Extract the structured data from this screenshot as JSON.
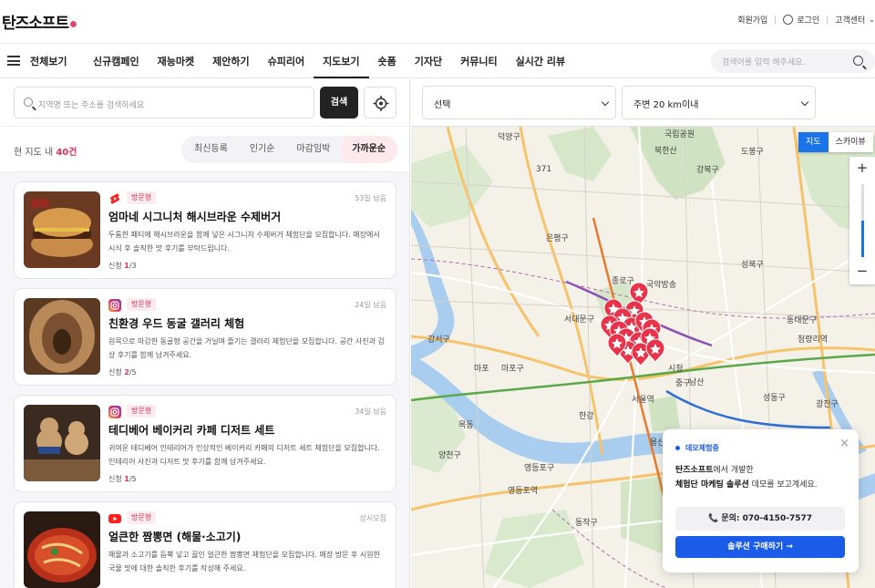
{
  "header": {
    "logo": "탄즈소프트",
    "links": [
      "회원가입",
      "로그인",
      "고객센터"
    ]
  },
  "nav": {
    "all_label": "전체보기",
    "items": [
      "신규캠페인",
      "재능마켓",
      "제안하기",
      "슈피리어",
      "지도보기",
      "숏폼",
      "기자단",
      "커뮤니티",
      "실시간 리뷰"
    ],
    "active": "지도보기",
    "search_placeholder": "검색어를 입력 해주세요."
  },
  "left": {
    "search_placeholder": "지역명 또는 주소를 검색하세요",
    "search_button": "검색",
    "count_prefix": "현 지도 내 ",
    "count_value": "40건",
    "sort_options": [
      "최신등록",
      "인기순",
      "마감임박",
      "가까운순"
    ],
    "sort_active": "가까운순"
  },
  "cards": [
    {
      "platform": "youtube-shorts",
      "badge": "방문형",
      "days_left": "53일 남음",
      "title": "엄마네 시그니처 해시브라운 수제버거",
      "desc": "두툼한 패티에 해시브라운을 함께 넣은 시그니처 수제버거 체험단을 모집합니다. 매장에서 시식 후 솔직한 맛 후기를 부탁드립니다.",
      "slots_label": "신청 ",
      "slots_current": "1",
      "slots_total": "/3"
    },
    {
      "platform": "instagram",
      "badge": "방문형",
      "days_left": "24일 남음",
      "title": "친환경 우드 동굴 갤러리 체험",
      "desc": "원목으로 마감한 동굴형 공간을 거닐며 즐기는 갤러리 체험단을 모집합니다. 공간 사진과 감상 후기를 함께 남겨주세요.",
      "slots_label": "신청 ",
      "slots_current": "2",
      "slots_total": "/5"
    },
    {
      "platform": "instagram",
      "badge": "방문형",
      "days_left": "34일 남음",
      "title": "테디베어 베이커리 카페 디저트 세트",
      "desc": "귀여운 테디베어 인테리어가 인상적인 베이커리 카페의 디저트 세트 체험단을 모집합니다. 인테리어 사진과 디저트 맛 후기를 함께 남겨주세요.",
      "slots_label": "신청 ",
      "slots_current": "1",
      "slots_total": "/5"
    },
    {
      "platform": "youtube",
      "badge": "방문형",
      "days_left": "상시모집",
      "title": "얼큰한 짬뽕면 (해물·소고기)",
      "desc": "해물과 소고기를 듬뿍 넣고 끓인 얼큰한 짬뽕면 체험단을 모집합니다. 매장 방문 후 시원한 국물 맛에 대한 솔직한 후기를 작성해 주세요.",
      "slots_label": "",
      "slots_current": "",
      "slots_total": ""
    }
  ],
  "map": {
    "filter_region": "선택",
    "filter_radius": "주변 20 km이내",
    "type_buttons": [
      "지도",
      "스카이뷰"
    ],
    "type_active": "지도",
    "zoom_plus": "+",
    "zoom_minus": "−",
    "zoom_level": 0.5,
    "labels": [
      "덕양구",
      "국립공원",
      "북한산",
      "강북구",
      "도봉구",
      "은평구",
      "성북구",
      "종로구",
      "국악방송",
      "서대문구",
      "인왕산",
      "동대문구",
      "청량리역",
      "마포구",
      "마포",
      "시청",
      "중구",
      "서울역",
      "성동구",
      "광진구",
      "강서구",
      "양천구",
      "영등포구",
      "동작구",
      "용산구",
      "남산",
      "목동",
      "영등포역",
      "한강",
      "371"
    ],
    "marker_count": 16,
    "marker_color": "#e8334a"
  },
  "demo": {
    "tag": "데모체험중",
    "close": "×",
    "brand": "탄즈소프트",
    "line1_suffix": "에서 개발한",
    "line2_bold": "체험단 마케팅 솔루션",
    "line2_suffix": " 데모를 보고계세요.",
    "phone": "문의: 070-4150-7577",
    "buy": "솔루션 구매하기 →"
  }
}
